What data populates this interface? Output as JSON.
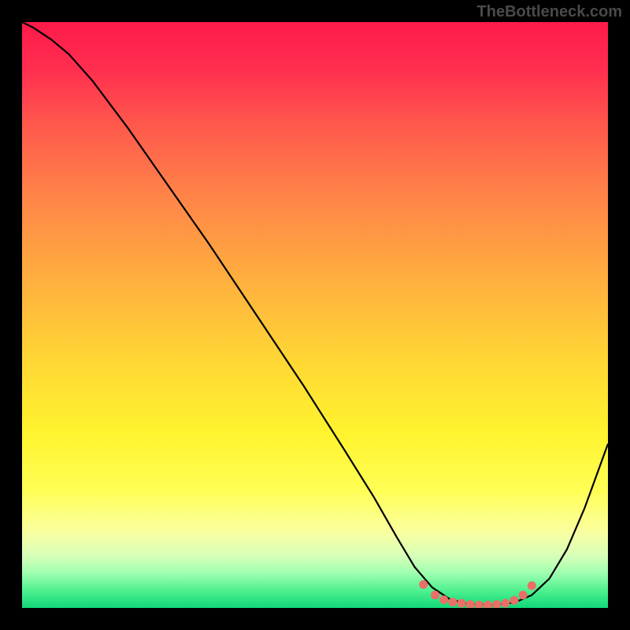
{
  "watermark": "TheBottleneck.com",
  "chart_data": {
    "type": "line",
    "title": "",
    "xlabel": "",
    "ylabel": "",
    "xlim": [
      0,
      100
    ],
    "ylim": [
      0,
      100
    ],
    "background_gradient": {
      "stops": [
        {
          "pos": 0.0,
          "color": "#ff1a4a"
        },
        {
          "pos": 0.08,
          "color": "#ff2e4f"
        },
        {
          "pos": 0.18,
          "color": "#ff5a4c"
        },
        {
          "pos": 0.3,
          "color": "#ff8548"
        },
        {
          "pos": 0.45,
          "color": "#ffb23e"
        },
        {
          "pos": 0.58,
          "color": "#ffd734"
        },
        {
          "pos": 0.7,
          "color": "#fff32e"
        },
        {
          "pos": 0.8,
          "color": "#ffff55"
        },
        {
          "pos": 0.87,
          "color": "#faffa0"
        },
        {
          "pos": 0.91,
          "color": "#d8ffb8"
        },
        {
          "pos": 0.94,
          "color": "#a0ffb0"
        },
        {
          "pos": 0.97,
          "color": "#50f090"
        },
        {
          "pos": 1.0,
          "color": "#10d878"
        }
      ]
    },
    "series": [
      {
        "name": "curve",
        "color": "#000000",
        "points": [
          {
            "x": 0,
            "y": 100
          },
          {
            "x": 2,
            "y": 99
          },
          {
            "x": 5,
            "y": 97
          },
          {
            "x": 8,
            "y": 94.5
          },
          {
            "x": 12,
            "y": 90
          },
          {
            "x": 18,
            "y": 82
          },
          {
            "x": 25,
            "y": 72
          },
          {
            "x": 32,
            "y": 62
          },
          {
            "x": 40,
            "y": 50
          },
          {
            "x": 48,
            "y": 38
          },
          {
            "x": 55,
            "y": 27
          },
          {
            "x": 60,
            "y": 19
          },
          {
            "x": 64,
            "y": 12
          },
          {
            "x": 67,
            "y": 7
          },
          {
            "x": 70,
            "y": 3.5
          },
          {
            "x": 73,
            "y": 1.5
          },
          {
            "x": 76,
            "y": 0.7
          },
          {
            "x": 80,
            "y": 0.5
          },
          {
            "x": 84,
            "y": 0.9
          },
          {
            "x": 87,
            "y": 2.2
          },
          {
            "x": 90,
            "y": 5
          },
          {
            "x": 93,
            "y": 10
          },
          {
            "x": 96,
            "y": 17
          },
          {
            "x": 100,
            "y": 28
          }
        ]
      },
      {
        "name": "highlight-dots",
        "color": "#e87066",
        "points": [
          {
            "x": 68.5,
            "y": 4.0
          },
          {
            "x": 70.5,
            "y": 2.2
          },
          {
            "x": 72.0,
            "y": 1.4
          },
          {
            "x": 73.5,
            "y": 1.0
          },
          {
            "x": 75.0,
            "y": 0.8
          },
          {
            "x": 76.5,
            "y": 0.6
          },
          {
            "x": 78.0,
            "y": 0.5
          },
          {
            "x": 79.5,
            "y": 0.5
          },
          {
            "x": 81.0,
            "y": 0.6
          },
          {
            "x": 82.5,
            "y": 0.8
          },
          {
            "x": 84.0,
            "y": 1.3
          },
          {
            "x": 85.5,
            "y": 2.2
          },
          {
            "x": 87.0,
            "y": 3.8
          }
        ]
      }
    ]
  }
}
